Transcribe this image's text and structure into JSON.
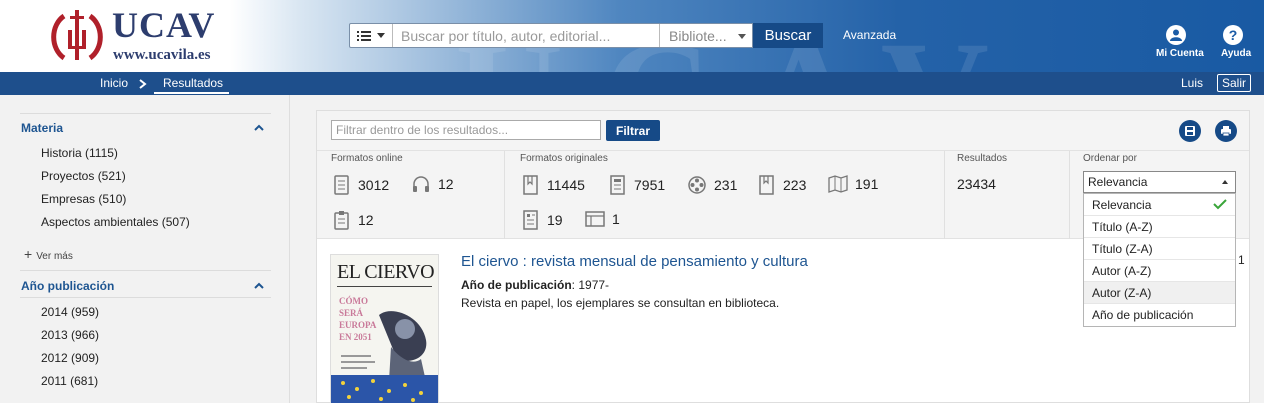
{
  "header": {
    "logo_title": "UCAV",
    "logo_url": "www.ucavila.es",
    "search_placeholder": "Buscar por título, autor, editorial...",
    "library_select": "Bibliote...",
    "search_button": "Buscar",
    "advanced_link": "Avanzada",
    "account_label": "Mi Cuenta",
    "help_label": "Ayuda"
  },
  "nav": {
    "breadcrumb": [
      "Inicio",
      "Resultados"
    ],
    "user": "Luis",
    "logout": "Salir"
  },
  "sidebar": {
    "facets": [
      {
        "title": "Materia",
        "items": [
          "Historia (1115)",
          "Proyectos (521)",
          "Empresas (510)",
          "Aspectos ambientales (507)"
        ],
        "more": "Ver más"
      },
      {
        "title": "Año publicación",
        "items": [
          "2014 (959)",
          "2013 (966)",
          "2012 (909)",
          "2011 (681)"
        ]
      }
    ]
  },
  "toolbar": {
    "filter_placeholder": "Filtrar dentro de los resultados...",
    "filter_button": "Filtrar",
    "save_icon": "save-icon",
    "print_icon": "print-icon"
  },
  "stats": {
    "online_heading": "Formatos online",
    "online": [
      {
        "icon": "ebook-icon",
        "count": "3012"
      },
      {
        "icon": "headphones-icon",
        "count": "12"
      },
      {
        "icon": "clipboard-icon",
        "count": "12"
      }
    ],
    "original_heading": "Formatos originales",
    "original": [
      {
        "icon": "book-icon",
        "count": "11445"
      },
      {
        "icon": "document-icon",
        "count": "7951"
      },
      {
        "icon": "film-reel-icon",
        "count": "231"
      },
      {
        "icon": "bookmark-icon",
        "count": "223"
      },
      {
        "icon": "map-icon",
        "count": "191"
      },
      {
        "icon": "newspaper-icon",
        "count": "19"
      },
      {
        "icon": "window-icon",
        "count": "1"
      }
    ],
    "results_heading": "Resultados",
    "results_count": "23434",
    "sort_heading": "Ordenar por",
    "sort_selected": "Relevancia",
    "sort_options": [
      "Relevancia",
      "Título (A-Z)",
      "Título (Z-A)",
      "Autor (A-Z)",
      "Autor (Z-A)",
      "Año de publicación"
    ]
  },
  "result": {
    "title": "El ciervo : revista mensual de pensamiento y cultura",
    "year_label": "Año de publicación",
    "year_value": ": 1977-",
    "description": "Revista en papel, los ejemplares se consultan en biblioteca.",
    "number": "1",
    "cover_title": "EL CIERVO",
    "cover_headline": "CÓMO SERÁ EUROPA EN 2051"
  },
  "colors": {
    "brand_dark": "#164a87",
    "nav_bar": "#1e4f8c",
    "link": "#1e5591",
    "check": "#3aa53a"
  }
}
